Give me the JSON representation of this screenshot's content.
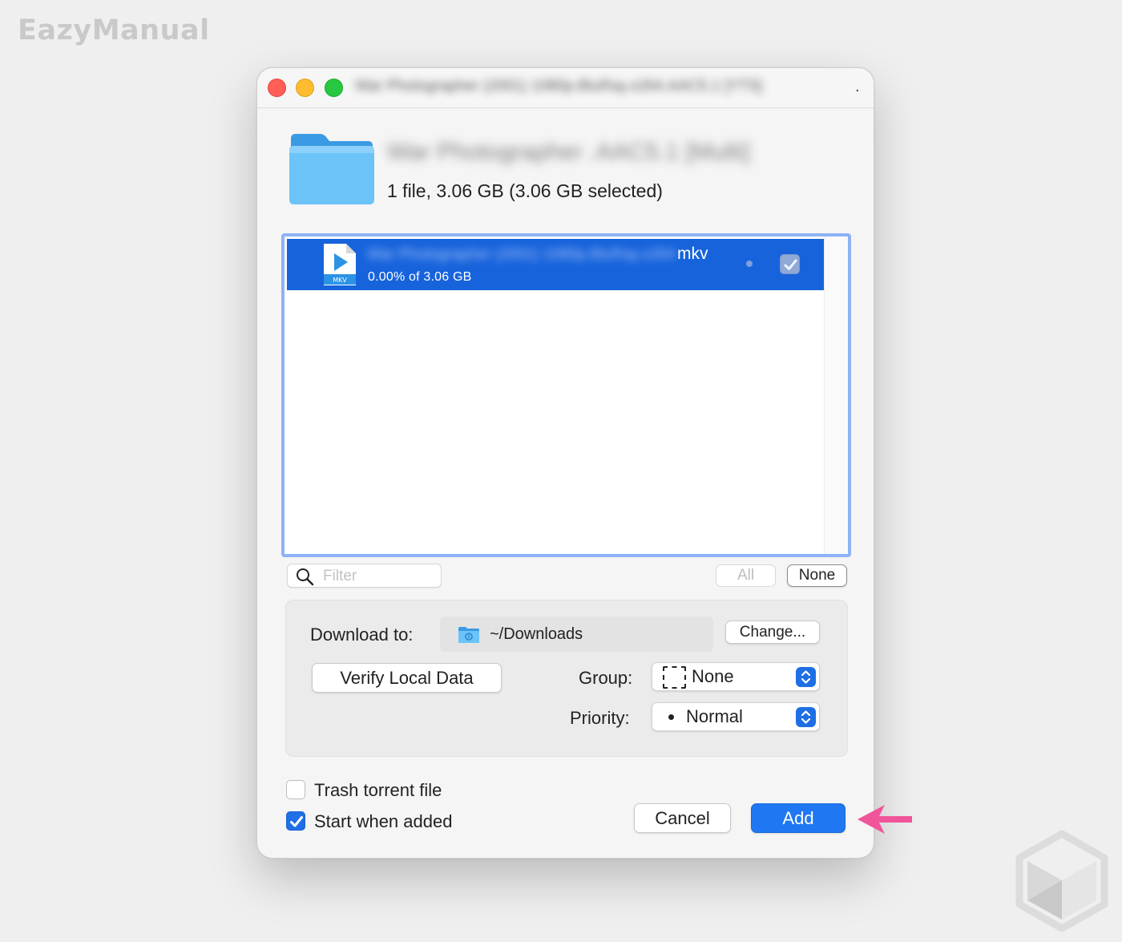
{
  "watermark": "EazyManual",
  "window": {
    "title": "War Photographer (2001) 1080p.BluRay.x264.AAC5.1 [YTS]",
    "title_dot": "."
  },
  "torrent": {
    "name": "War Photographer .AAC5.1 [Multi]",
    "info": "1 file, 3.06 GB (3.06 GB selected)"
  },
  "files": [
    {
      "name": "War Photographer (2001) 1080p.BluRay.x264",
      "ext": "mkv",
      "icon_label": "MKV",
      "progress": "0.00% of 3.06 GB",
      "checked": true
    }
  ],
  "filter": {
    "placeholder": "Filter",
    "value": ""
  },
  "select_buttons": {
    "all": "All",
    "none": "None"
  },
  "options": {
    "download_label": "Download to:",
    "download_path": "~/Downloads",
    "change_label": "Change...",
    "verify_label": "Verify Local Data",
    "group_label": "Group:",
    "group_value": "None",
    "priority_label": "Priority:",
    "priority_value": "Normal"
  },
  "checkboxes": {
    "trash_label": "Trash torrent file",
    "trash_checked": false,
    "start_label": "Start when added",
    "start_checked": true
  },
  "actions": {
    "cancel": "Cancel",
    "add": "Add"
  },
  "colors": {
    "accent": "#1f78f2",
    "selection": "#1763dc",
    "annotation_arrow": "#f0559a",
    "close": "#ff5f57",
    "minimize": "#febc2e",
    "maximize": "#28c840"
  }
}
